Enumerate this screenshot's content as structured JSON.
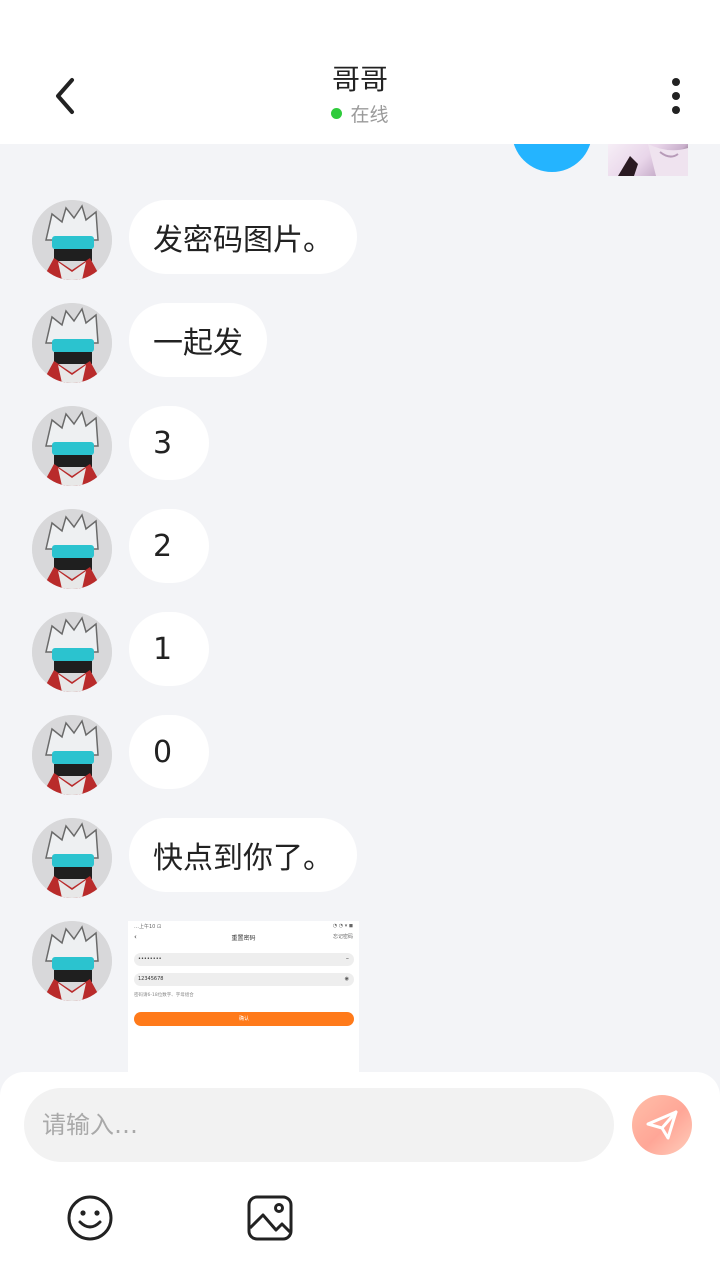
{
  "header": {
    "title": "哥哥",
    "status": "在线",
    "status_color": "#2fcb3c",
    "back_icon": "chevron-left-icon",
    "more_icon": "more-vertical-icon"
  },
  "messages": [
    {
      "sender": "contact",
      "type": "text",
      "text": "发密码图片。"
    },
    {
      "sender": "contact",
      "type": "text",
      "text": "一起发"
    },
    {
      "sender": "contact",
      "type": "text",
      "text": "3"
    },
    {
      "sender": "contact",
      "type": "text",
      "text": "2"
    },
    {
      "sender": "contact",
      "type": "text",
      "text": "1"
    },
    {
      "sender": "contact",
      "type": "text",
      "text": "0"
    },
    {
      "sender": "contact",
      "type": "text",
      "text": "快点到你了。"
    },
    {
      "sender": "contact",
      "type": "image",
      "image": {
        "status_left": "…上午10 ⊡",
        "status_right": "◔ ◔ ▾ ◼",
        "title": "重置密码",
        "right_label": "忘记密码",
        "field1": "••••••••",
        "field2": "12345678",
        "hint": "密码请6-18位数字、字母组合",
        "button": "确认",
        "button_color": "#ff7a1a"
      }
    }
  ],
  "composer": {
    "placeholder": "请输入…",
    "send_icon": "send-icon",
    "emoji_icon": "emoji-icon",
    "image_icon": "image-icon"
  },
  "colors": {
    "background": "#f3f4f7",
    "bubble": "#ffffff",
    "accent_bubble": "#24b4ff"
  }
}
